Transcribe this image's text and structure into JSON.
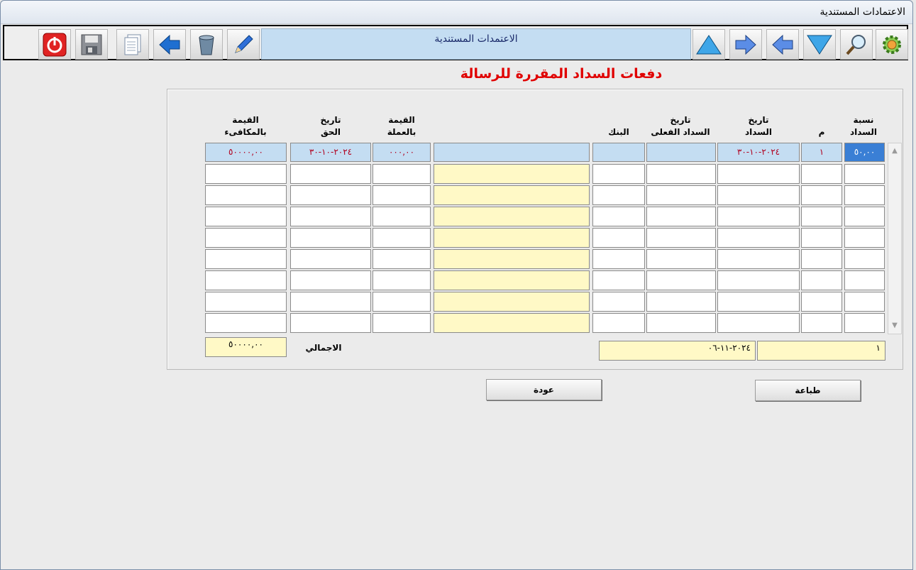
{
  "window": {
    "title": "الاعتمادات المستندية"
  },
  "toolbar": {
    "title": "الاعتمدات المستندية",
    "buttons": [
      "power-icon",
      "save-icon",
      "copy-icon",
      "back-icon",
      "trash-icon",
      "edit-icon",
      "up-icon",
      "next-icon",
      "prev-icon",
      "down-icon",
      "search-icon",
      "settings-icon"
    ]
  },
  "page": {
    "heading": "دفعات السداد المقررة للرسالة"
  },
  "table": {
    "headers": {
      "pct": [
        "نسبة",
        "السداد"
      ],
      "m": [
        "م"
      ],
      "due_date": [
        "تاريخ",
        "السداد"
      ],
      "actual_date": [
        "تاريخ",
        "السداد الفعلى"
      ],
      "bank": [
        "البنك"
      ],
      "blank": [
        ""
      ],
      "value_currency": [
        "القيمة",
        "بالعملة"
      ],
      "right_date": [
        "تاريخ",
        "الحق"
      ],
      "value_equiv": [
        "القيمة",
        "بالمكافىء"
      ]
    },
    "rows": [
      {
        "pct": "٥٠,٠٠",
        "m": "١",
        "due_date": "٢٠٢٤-١٠-٣٠",
        "actual_date": "",
        "bank": "",
        "blank": "",
        "value_currency": "٠٠٠,٠٠",
        "right_date": "٢٠٢٤-١٠-٣٠",
        "value_equiv": "٥٠٠٠٠,٠٠"
      },
      {
        "pct": "",
        "m": "",
        "due_date": "",
        "actual_date": "",
        "bank": "",
        "blank": "",
        "value_currency": "",
        "right_date": "",
        "value_equiv": ""
      },
      {
        "pct": "",
        "m": "",
        "due_date": "",
        "actual_date": "",
        "bank": "",
        "blank": "",
        "value_currency": "",
        "right_date": "",
        "value_equiv": ""
      },
      {
        "pct": "",
        "m": "",
        "due_date": "",
        "actual_date": "",
        "bank": "",
        "blank": "",
        "value_currency": "",
        "right_date": "",
        "value_equiv": ""
      },
      {
        "pct": "",
        "m": "",
        "due_date": "",
        "actual_date": "",
        "bank": "",
        "blank": "",
        "value_currency": "",
        "right_date": "",
        "value_equiv": ""
      },
      {
        "pct": "",
        "m": "",
        "due_date": "",
        "actual_date": "",
        "bank": "",
        "blank": "",
        "value_currency": "",
        "right_date": "",
        "value_equiv": ""
      },
      {
        "pct": "",
        "m": "",
        "due_date": "",
        "actual_date": "",
        "bank": "",
        "blank": "",
        "value_currency": "",
        "right_date": "",
        "value_equiv": ""
      },
      {
        "pct": "",
        "m": "",
        "due_date": "",
        "actual_date": "",
        "bank": "",
        "blank": "",
        "value_currency": "",
        "right_date": "",
        "value_equiv": ""
      },
      {
        "pct": "",
        "m": "",
        "due_date": "",
        "actual_date": "",
        "bank": "",
        "blank": "",
        "value_currency": "",
        "right_date": "",
        "value_equiv": ""
      }
    ]
  },
  "footer": {
    "field_number": "١",
    "field_date": "٢٠٢٤-١١-٠٦",
    "total_label": "الاجمالي",
    "total_value": "٥٠٠٠٠,٠٠"
  },
  "buttons": {
    "print": "طباعة",
    "back": "عودة"
  },
  "colors": {
    "heading": "#e00000",
    "selected_row": "#c4ddf2",
    "editable": "#fff9c6",
    "value_text": "#b1001e"
  }
}
